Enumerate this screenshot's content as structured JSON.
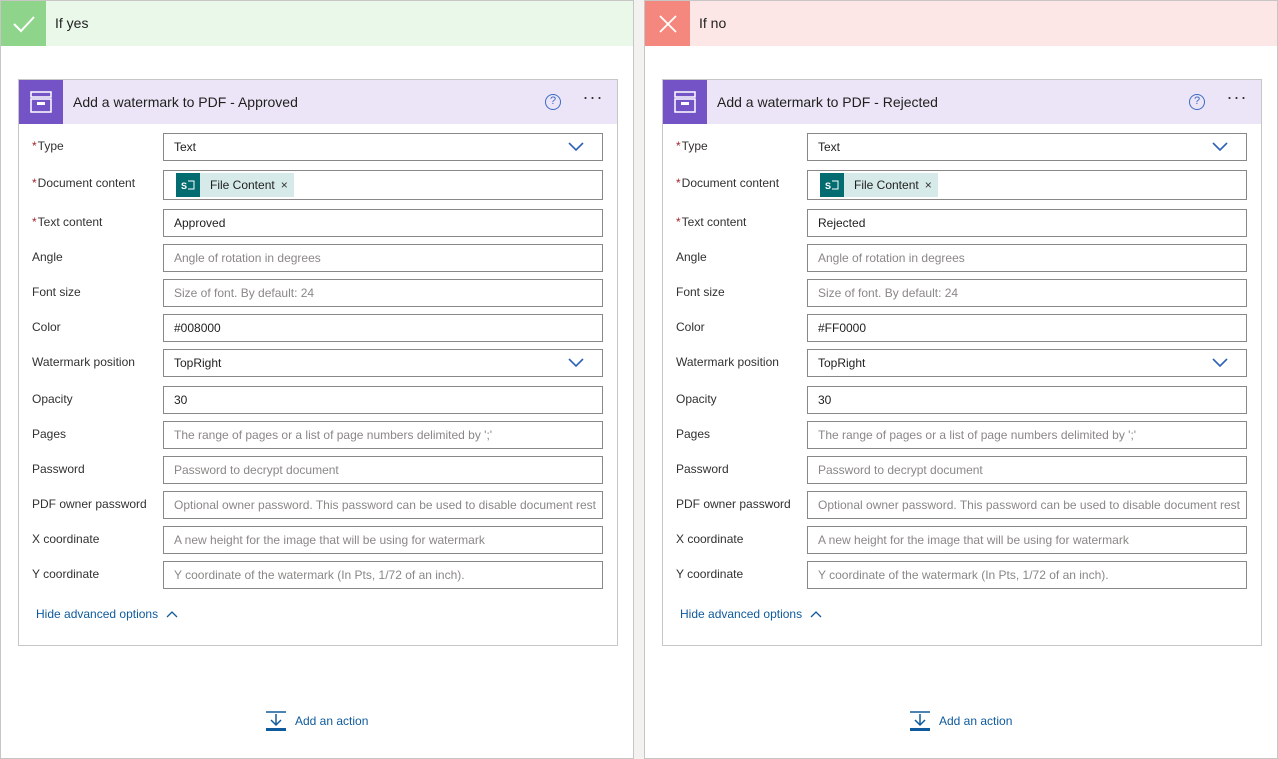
{
  "branches": [
    {
      "title": "If yes",
      "card": {
        "title": "Add a watermark to PDF - Approved",
        "help": "?",
        "more": "···",
        "fields": {
          "type": {
            "label": "Type",
            "value": "Text"
          },
          "document_content": {
            "label": "Document content",
            "token": "File Content",
            "token_close": "×"
          },
          "text_content": {
            "label": "Text content",
            "value": "Approved"
          },
          "angle": {
            "label": "Angle",
            "placeholder": "Angle of rotation in degrees"
          },
          "font_size": {
            "label": "Font size",
            "placeholder": "Size of font. By default: 24"
          },
          "color": {
            "label": "Color",
            "value": "#008000"
          },
          "watermark_position": {
            "label": "Watermark position",
            "value": "TopRight"
          },
          "opacity": {
            "label": "Opacity",
            "value": "30"
          },
          "pages": {
            "label": "Pages",
            "placeholder": "The range of pages or a list of page numbers delimited by ';'"
          },
          "password": {
            "label": "Password",
            "placeholder": "Password to decrypt document"
          },
          "pdf_owner_password": {
            "label": "PDF owner password",
            "placeholder": "Optional owner password. This password can be used to disable document rest"
          },
          "x_coordinate": {
            "label": "X coordinate",
            "placeholder": "A new height for the image that will be using for watermark"
          },
          "y_coordinate": {
            "label": "Y coordinate",
            "placeholder": "Y coordinate of the watermark (In Pts, 1/72 of an inch)."
          }
        },
        "hide_advanced": "Hide advanced options"
      },
      "add_action": "Add an action"
    },
    {
      "title": "If no",
      "card": {
        "title": "Add a watermark to PDF - Rejected",
        "help": "?",
        "more": "···",
        "fields": {
          "type": {
            "label": "Type",
            "value": "Text"
          },
          "document_content": {
            "label": "Document content",
            "token": "File Content",
            "token_close": "×"
          },
          "text_content": {
            "label": "Text content",
            "value": "Rejected"
          },
          "angle": {
            "label": "Angle",
            "placeholder": "Angle of rotation in degrees"
          },
          "font_size": {
            "label": "Font size",
            "placeholder": "Size of font. By default: 24"
          },
          "color": {
            "label": "Color",
            "value": "#FF0000"
          },
          "watermark_position": {
            "label": "Watermark position",
            "value": "TopRight"
          },
          "opacity": {
            "label": "Opacity",
            "value": "30"
          },
          "pages": {
            "label": "Pages",
            "placeholder": "The range of pages or a list of page numbers delimited by ';'"
          },
          "password": {
            "label": "Password",
            "placeholder": "Password to decrypt document"
          },
          "pdf_owner_password": {
            "label": "PDF owner password",
            "placeholder": "Optional owner password. This password can be used to disable document rest"
          },
          "x_coordinate": {
            "label": "X coordinate",
            "placeholder": "A new height for the image that will be using for watermark"
          },
          "y_coordinate": {
            "label": "Y coordinate",
            "placeholder": "Y coordinate of the watermark (In Pts, 1/72 of an inch)."
          }
        },
        "hide_advanced": "Hide advanced options"
      },
      "add_action": "Add an action"
    }
  ],
  "required_marker": "*",
  "colors": {
    "yes_header": "#eaf8ea",
    "yes_icon": "#8fd48b",
    "no_header": "#fde7e6",
    "no_icon": "#f4877e",
    "card_header": "#ebe5f7",
    "card_icon": "#7353c6",
    "token_bg": "#d6ebe9",
    "token_icon": "#036c70",
    "link": "#0e5a9c"
  },
  "icons": {
    "yes": "checkmark-icon",
    "no": "close-x-icon",
    "card": "pdf-archive-icon",
    "token": "sharepoint-icon",
    "add_action": "add-action-icon"
  }
}
